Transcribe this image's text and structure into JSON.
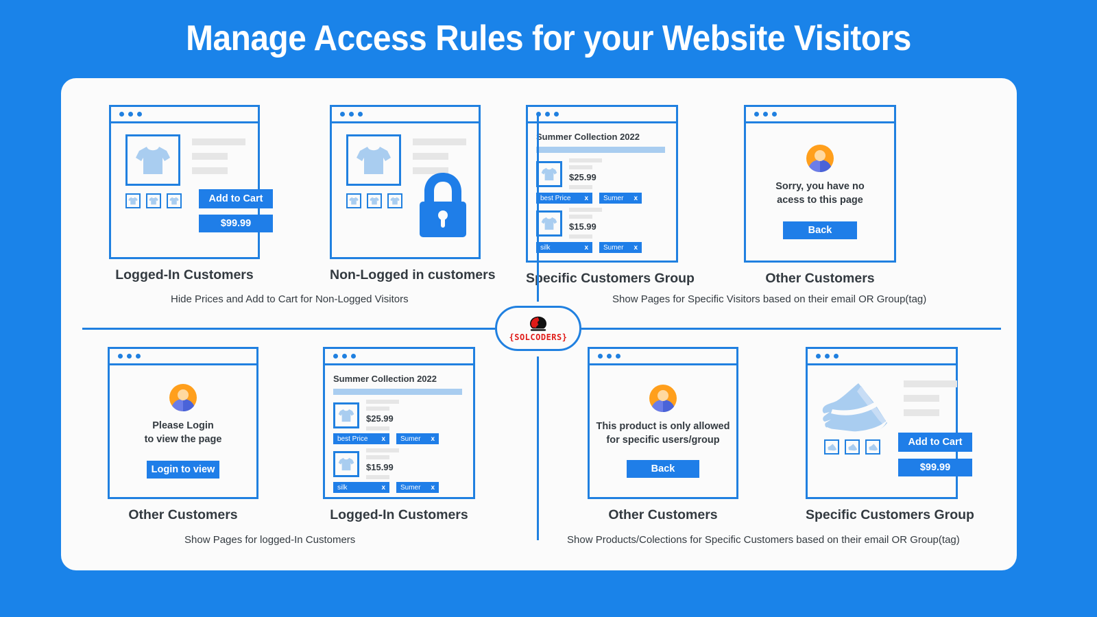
{
  "header": {
    "title": "Manage Access Rules for your Website Visitors"
  },
  "brand": {
    "name": "{SOLCODERS}",
    "logo_icon": "solcoders-mascot-icon",
    "accent": "#e01b18"
  },
  "colors": {
    "background": "#1a83e9",
    "panel": "#fbfbfb",
    "accent_blue": "#2080e0",
    "button_blue": "#1f7ee8",
    "avatar_orange": "#ff9f1c",
    "avatar_body": "#6b7de8",
    "garment_blue": "#a9cdf0",
    "placeholder_gray": "#e6e6e6",
    "text_dark": "#333a40"
  },
  "cards": [
    {
      "id": "logged-in-product",
      "kind": "product",
      "caption": "Logged-In Customers",
      "product_icon": "tshirt-icon",
      "thumb_icon": "tshirt-icon",
      "thumb_count": 3,
      "add_to_cart_label": "Add to Cart",
      "price": "$99.99",
      "show_buttons": true
    },
    {
      "id": "non-logged-product",
      "kind": "product",
      "caption": "Non-Logged in customers",
      "product_icon": "tshirt-icon",
      "thumb_icon": "tshirt-icon",
      "thumb_count": 3,
      "lock_icon": "padlock-icon",
      "show_buttons": false
    },
    {
      "id": "specific-group-collection",
      "kind": "collection",
      "caption": "Specific Customers Group",
      "collection_title": "Summer Collection 2022",
      "items": [
        {
          "icon": "tshirt-icon",
          "price": "$25.99",
          "tags": [
            {
              "label": "best Price",
              "remove": "x"
            },
            {
              "label": "Sumer",
              "remove": "x"
            }
          ]
        },
        {
          "icon": "tshirt-icon",
          "price": "$15.99",
          "tags": [
            {
              "label": "silk",
              "remove": "x"
            },
            {
              "label": "Sumer",
              "remove": "x"
            }
          ]
        }
      ]
    },
    {
      "id": "other-customers-no-access",
      "kind": "message",
      "caption": "Other Customers",
      "avatar_icon": "user-avatar-icon",
      "message_lines": [
        "Sorry, you have no",
        "acess to this page"
      ],
      "button_label": "Back"
    },
    {
      "id": "other-customers-login",
      "kind": "message",
      "caption": "Other Customers",
      "avatar_icon": "user-avatar-icon",
      "message_lines": [
        "Please Login",
        "to view the page"
      ],
      "button_label": "Login to view"
    },
    {
      "id": "logged-in-collection",
      "kind": "collection",
      "caption": "Logged-In Customers",
      "collection_title": "Summer Collection 2022",
      "items": [
        {
          "icon": "tshirt-icon",
          "price": "$25.99",
          "tags": [
            {
              "label": "best Price",
              "remove": "x"
            },
            {
              "label": "Sumer",
              "remove": "x"
            }
          ]
        },
        {
          "icon": "tshirt-icon",
          "price": "$15.99",
          "tags": [
            {
              "label": "silk",
              "remove": "x"
            },
            {
              "label": "Sumer",
              "remove": "x"
            }
          ]
        }
      ]
    },
    {
      "id": "other-customers-product-blocked",
      "kind": "message",
      "caption": "Other Customers",
      "avatar_icon": "user-avatar-icon",
      "message_lines": [
        "This product is only allowed",
        "for specific users/group"
      ],
      "button_label": "Back"
    },
    {
      "id": "specific-group-product",
      "kind": "product",
      "caption": "Specific Customers Group",
      "product_icon": "shoe-icon",
      "thumb_icon": "shoe-icon",
      "thumb_count": 3,
      "add_to_cart_label": "Add to Cart",
      "price": "$99.99",
      "show_buttons": true
    }
  ],
  "captions": {
    "top_left": "Hide Prices and Add to Cart for Non-Logged Visitors",
    "top_right": "Show Pages for Specific Visitors based on their email OR Group(tag)",
    "bottom_left": "Show Pages for logged-In Customers",
    "bottom_right": "Show Products/Colections for Specific Customers based on their email OR Group(tag)"
  }
}
